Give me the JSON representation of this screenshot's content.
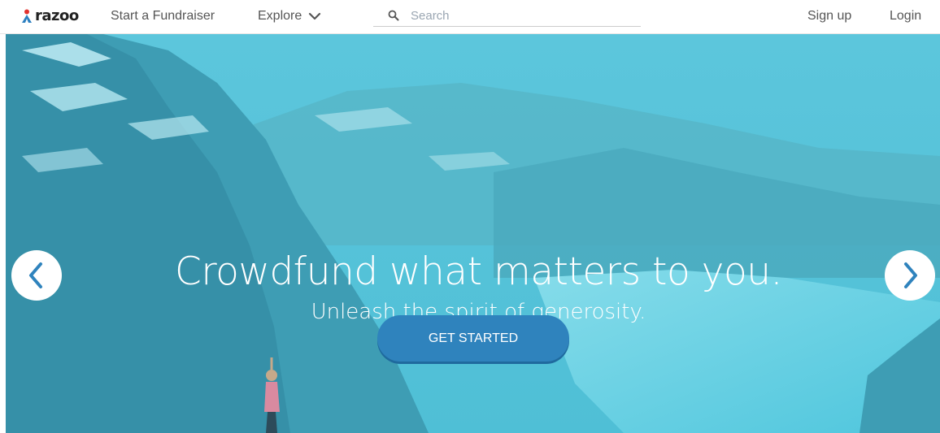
{
  "navbar": {
    "logo_text": "razoo",
    "start_fundraiser": "Start a Fundraiser",
    "explore": "Explore",
    "search_placeholder": "Search",
    "sign_up": "Sign up",
    "login": "Login"
  },
  "hero": {
    "headline": "Crowdfund what matters to you.",
    "subheadline": "Unleash the spirit of generosity.",
    "cta_label": "GET STARTED"
  },
  "colors": {
    "brand_blue": "#2f83bd",
    "hero_tint": "#4cc3da",
    "logo_red": "#e2322f",
    "logo_blue": "#2b7fc0"
  },
  "icons": {
    "explore": "chevron-down-icon",
    "search": "search-icon",
    "prev": "chevron-left-icon",
    "next": "chevron-right-icon"
  }
}
